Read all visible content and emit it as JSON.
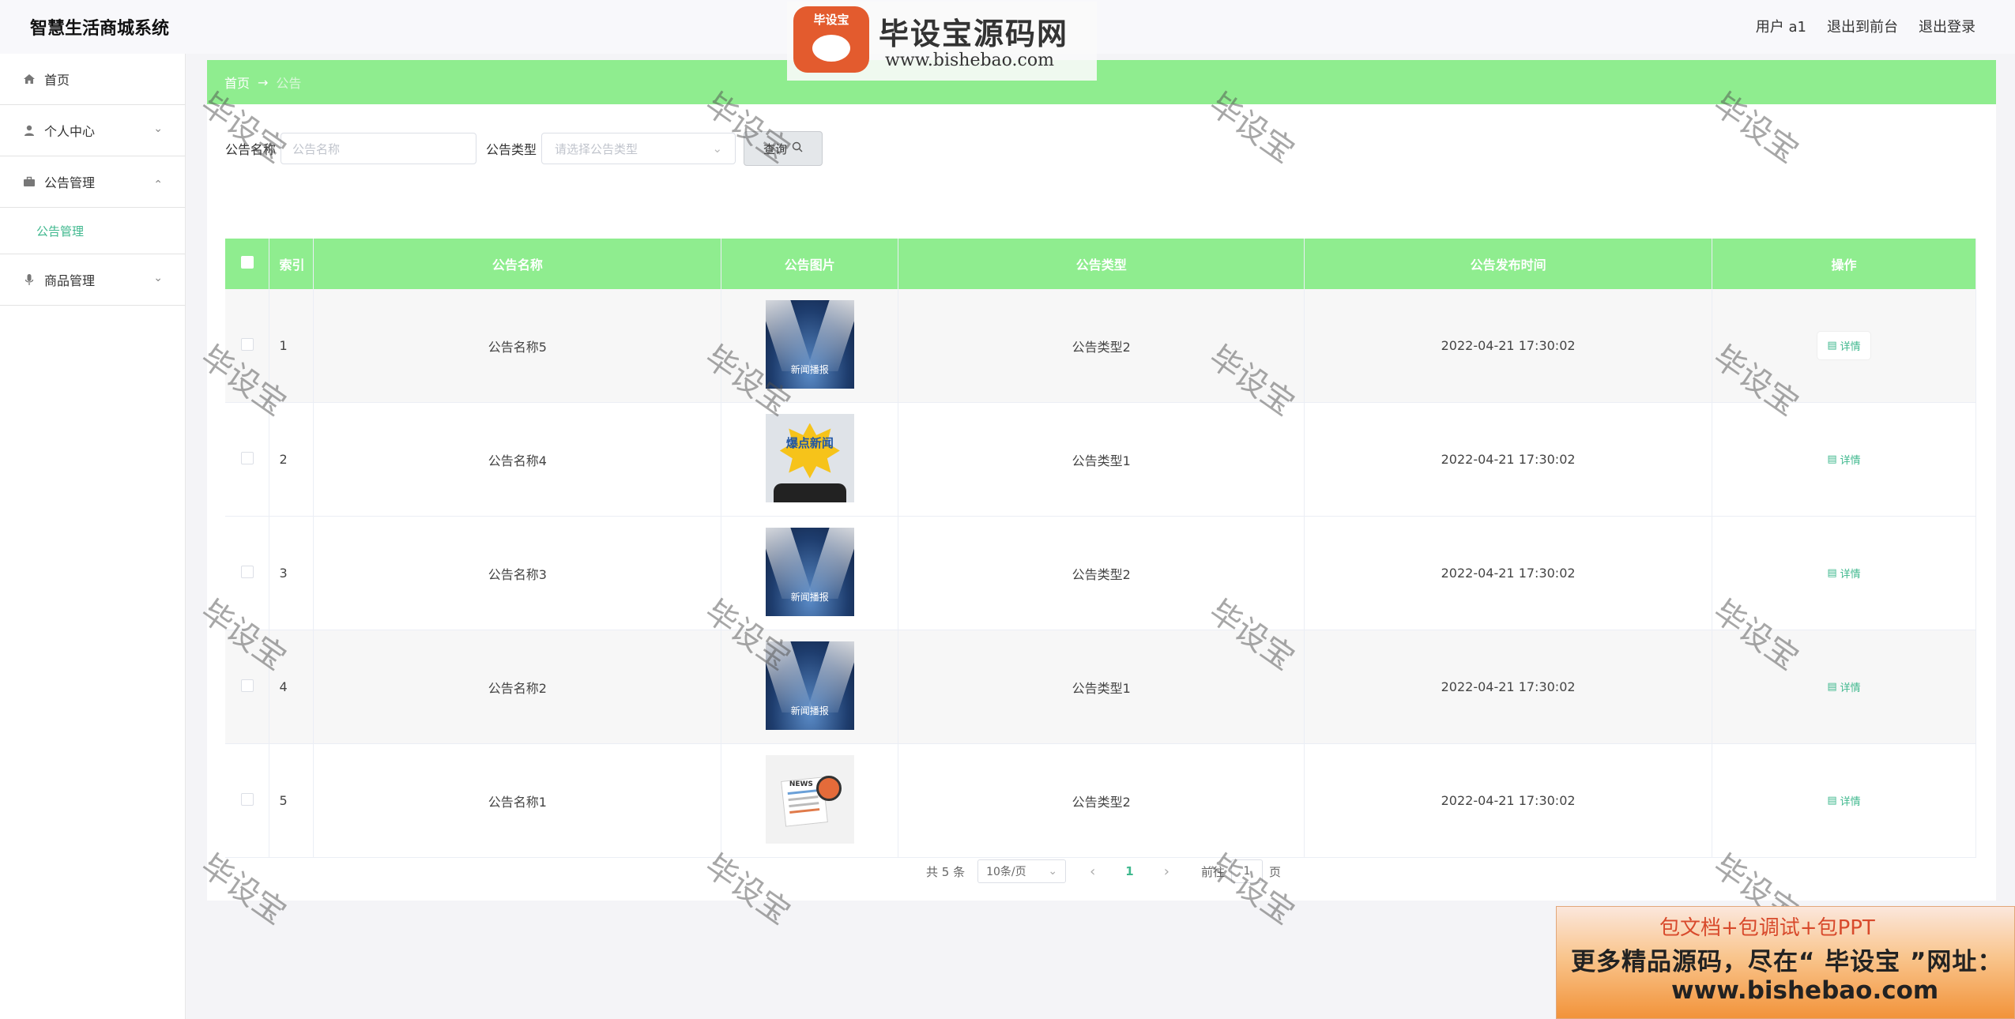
{
  "app": {
    "title": "智慧生活商城系统"
  },
  "header": {
    "user": "用户 a1",
    "to_front": "退出到前台",
    "logout": "退出登录"
  },
  "sidebar": {
    "items": [
      {
        "label": "首页",
        "icon": "home-icon"
      },
      {
        "label": "个人中心",
        "icon": "user-icon"
      },
      {
        "label": "公告管理",
        "icon": "briefcase-icon",
        "sub": "公告管理"
      },
      {
        "label": "商品管理",
        "icon": "microphone-icon"
      }
    ]
  },
  "breadcrumb": {
    "home": "首页",
    "arrow": "→",
    "current": "公告"
  },
  "search": {
    "name_label": "公告名称",
    "name_placeholder": "公告名称",
    "type_label": "公告类型",
    "type_placeholder": "请选择公告类型",
    "query_label": "查询"
  },
  "table": {
    "headers": [
      "索引",
      "公告名称",
      "公告图片",
      "公告类型",
      "公告发布时间",
      "操作"
    ],
    "rows": [
      {
        "index": "1",
        "name": "公告名称5",
        "image": "stage",
        "image_text": "新闻播报",
        "type": "公告类型2",
        "time": "2022-04-21 17:30:02",
        "action": "详情"
      },
      {
        "index": "2",
        "name": "公告名称4",
        "image": "burst",
        "image_text": "爆点新闻",
        "type": "公告类型1",
        "time": "2022-04-21 17:30:02",
        "action": "详情"
      },
      {
        "index": "3",
        "name": "公告名称3",
        "image": "stage",
        "image_text": "新闻播报",
        "type": "公告类型2",
        "time": "2022-04-21 17:30:02",
        "action": "详情"
      },
      {
        "index": "4",
        "name": "公告名称2",
        "image": "stage",
        "image_text": "新闻播报",
        "type": "公告类型1",
        "time": "2022-04-21 17:30:02",
        "action": "详情"
      },
      {
        "index": "5",
        "name": "公告名称1",
        "image": "news",
        "image_text": "NEWS",
        "type": "公告类型2",
        "time": "2022-04-21 17:30:02",
        "action": "详情"
      }
    ]
  },
  "pagination": {
    "total": "共 5 条",
    "page_size": "10条/页",
    "current": "1",
    "goto_prefix": "前往",
    "goto_value": "1",
    "goto_suffix": "页"
  },
  "watermarks": {
    "text": "毕设宝"
  },
  "logo": {
    "badge": "毕设宝",
    "brand": "毕设宝源码网",
    "url": "www.bishebao.com"
  },
  "promo": {
    "line1": "包文档+包调试+包PPT",
    "line2": "更多精品源码，尽在“ 毕设宝 ”网址：",
    "line3": "www.bishebao.com"
  },
  "colors": {
    "accent_green": "#8fed8f",
    "link_green": "#3fb88e"
  }
}
